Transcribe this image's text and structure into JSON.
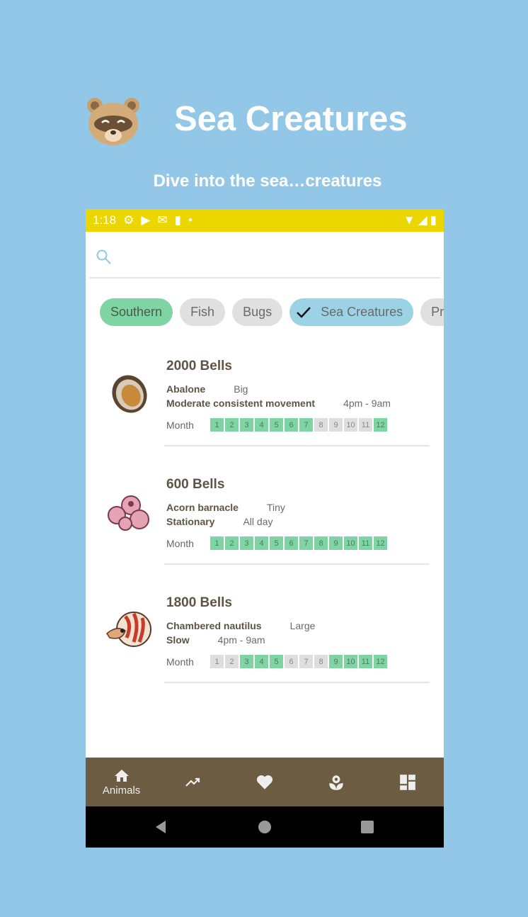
{
  "header": {
    "title": "Sea Creatures",
    "subtitle": "Dive into the sea…creatures"
  },
  "status": {
    "time": "1:18"
  },
  "search": {
    "placeholder": ""
  },
  "chips": [
    {
      "label": "Southern",
      "state": "hemisphere"
    },
    {
      "label": "Fish"
    },
    {
      "label": "Bugs"
    },
    {
      "label": "Sea Creatures",
      "selected": true
    },
    {
      "label": "Pric"
    }
  ],
  "month_label": "Month",
  "items": [
    {
      "price": "2000 Bells",
      "name": "Abalone",
      "size": "Big",
      "movement": "Moderate consistent movement",
      "time": "4pm - 9am",
      "months_active": [
        1,
        2,
        3,
        4,
        5,
        6,
        7,
        12
      ]
    },
    {
      "price": "600 Bells",
      "name": "Acorn barnacle",
      "size": "Tiny",
      "movement": "Stationary",
      "time": "All day",
      "months_active": [
        1,
        2,
        3,
        4,
        5,
        6,
        7,
        8,
        9,
        10,
        11,
        12
      ]
    },
    {
      "price": "1800 Bells",
      "name": "Chambered nautilus",
      "size": "Large",
      "movement": "Slow",
      "time": "4pm - 9am",
      "months_active": [
        3,
        4,
        5,
        9,
        10,
        11,
        12
      ]
    }
  ],
  "bottom_nav": [
    {
      "icon": "home-icon",
      "label": "Animals"
    },
    {
      "icon": "trending-icon"
    },
    {
      "icon": "heart-icon"
    },
    {
      "icon": "flower-icon"
    },
    {
      "icon": "dashboard-icon"
    }
  ],
  "colors": {
    "background": "#93c7e8",
    "status_bar": "#ecd600",
    "active_month": "#7fd4a4",
    "nav": "#6b5c42"
  }
}
